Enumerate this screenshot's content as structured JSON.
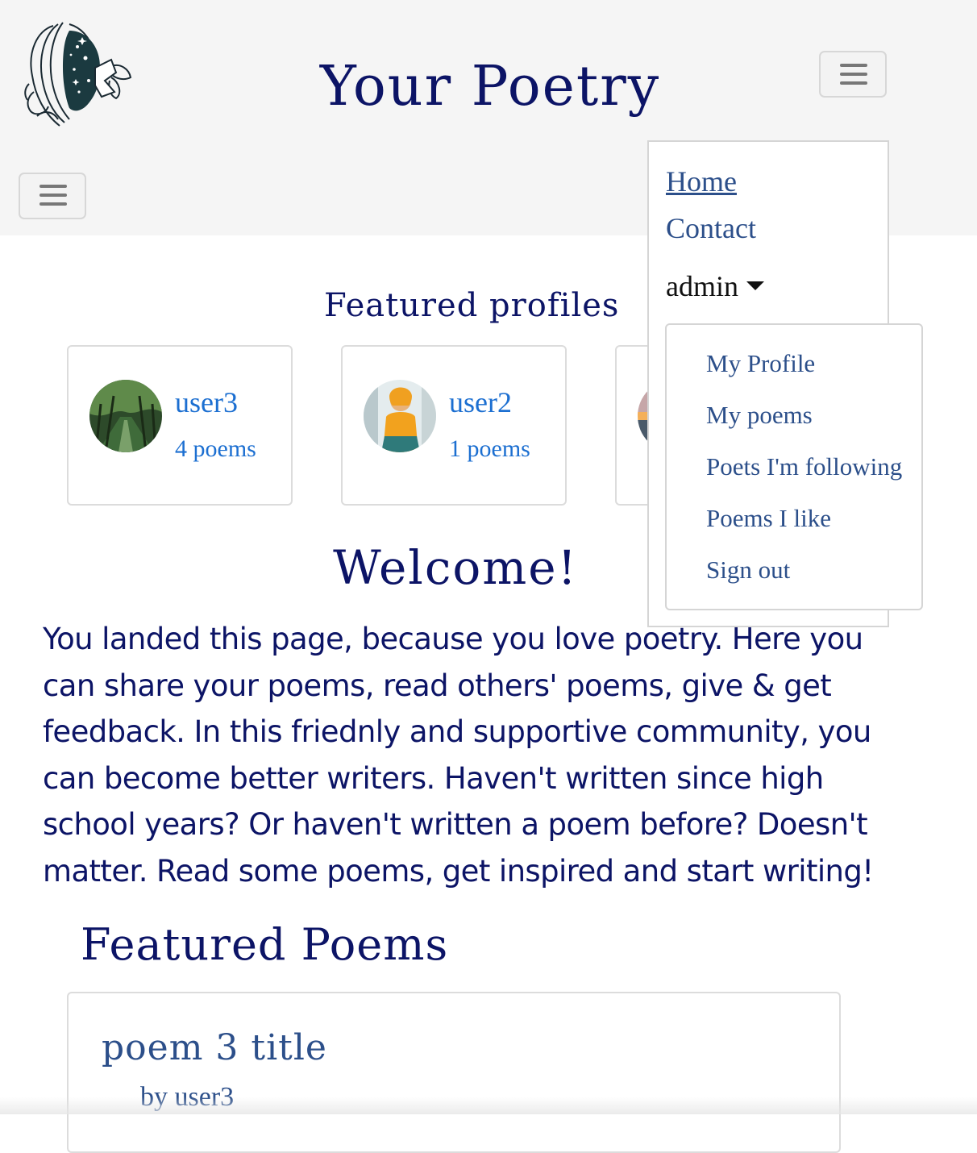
{
  "header": {
    "site_title": "Your Poetry",
    "logo_icon": "woman-butterfly-logo-icon",
    "menu_icon": "hamburger-icon"
  },
  "nav": {
    "home": "Home",
    "contact": "Contact",
    "user": "admin",
    "user_menu": [
      "My Profile",
      "My poems",
      "Poets I'm following",
      "Poems I like",
      "Sign out"
    ]
  },
  "featured_profiles": {
    "title": "Featured profiles",
    "profiles": [
      {
        "name": "user3",
        "poems": "4 poems"
      },
      {
        "name": "user2",
        "poems": "1 poems"
      }
    ]
  },
  "welcome": {
    "title": "Welcome!",
    "text": "You landed this page, because you love poetry. Here you can share your poems, read others' poems, give & get feedback. In this friednly and supportive community, you can become better writers. Haven't written since high school years? Or haven't written a poem before? Doesn't matter. Read some poems, get inspired and start writing!"
  },
  "featured_poems": {
    "title": "Featured Poems",
    "poems": [
      {
        "title": "poem 3 title",
        "author": "by user3"
      }
    ]
  },
  "colors": {
    "navy": "#0c1466",
    "link": "#1c6fd1",
    "nav_link": "#2c4f8a",
    "header_bg": "#f5f5f5"
  }
}
